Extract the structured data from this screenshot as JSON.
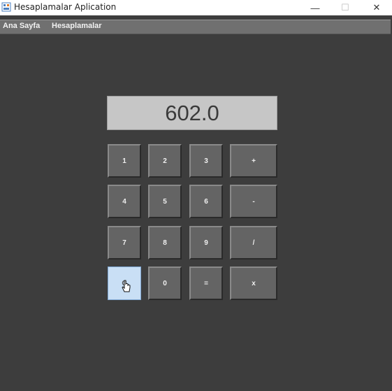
{
  "window": {
    "title": "Hesaplamalar Aplication",
    "minimize": "—",
    "maximize": "☐",
    "close": "✕"
  },
  "menu": {
    "items": [
      "Ana Sayfa",
      "Hesaplamalar"
    ]
  },
  "display": {
    "value": "602.0"
  },
  "keys": {
    "k1": "1",
    "k2": "2",
    "k3": "3",
    "plus": "+",
    "k4": "4",
    "k5": "5",
    "k6": "6",
    "minus": "-",
    "k7": "7",
    "k8": "8",
    "k9": "9",
    "divide": "/",
    "clear": "C",
    "k0": "0",
    "equals": "=",
    "multiply": "x"
  },
  "colors": {
    "background": "#3d3d3d",
    "menubar": "#707070",
    "display_bg": "#c6c6c6",
    "key_bg": "#646464",
    "key_pressed": "#c9dff5"
  }
}
